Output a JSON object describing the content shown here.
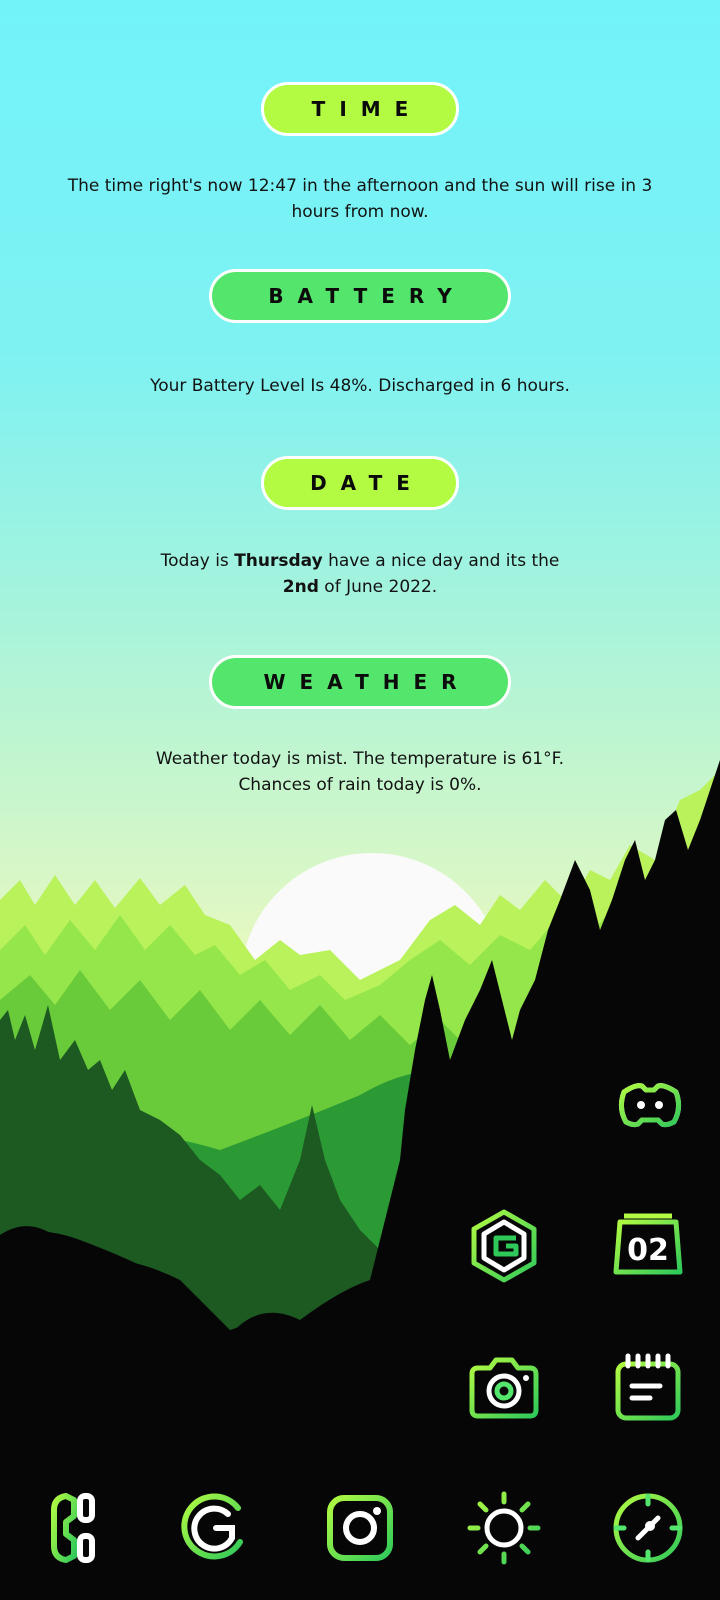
{
  "widget": {
    "time": {
      "label": "TIME",
      "text": "The time right's now 12:47 in the afternoon and the sun will rise in 3 hours from now."
    },
    "battery": {
      "label": "BATTERY",
      "text": "Your Battery Level Is 48%. Discharged in 6 hours."
    },
    "date": {
      "label": "DATE",
      "prefix": "Today is ",
      "day": "Thursday",
      "middle": " have a nice day and its the ",
      "daynum": "2nd",
      "suffix": " of June 2022."
    },
    "weather": {
      "label": "WEATHER",
      "text": "Weather today is mist. The temperature is 61°F. Chances of rain today is 0%."
    }
  },
  "icons": {
    "calendar_day": "02"
  },
  "colors": {
    "accent_lime": "#b2fb42",
    "accent_green": "#54e56c",
    "icon_gradient_start": "#b2fb42",
    "icon_gradient_end": "#2fc95a"
  }
}
